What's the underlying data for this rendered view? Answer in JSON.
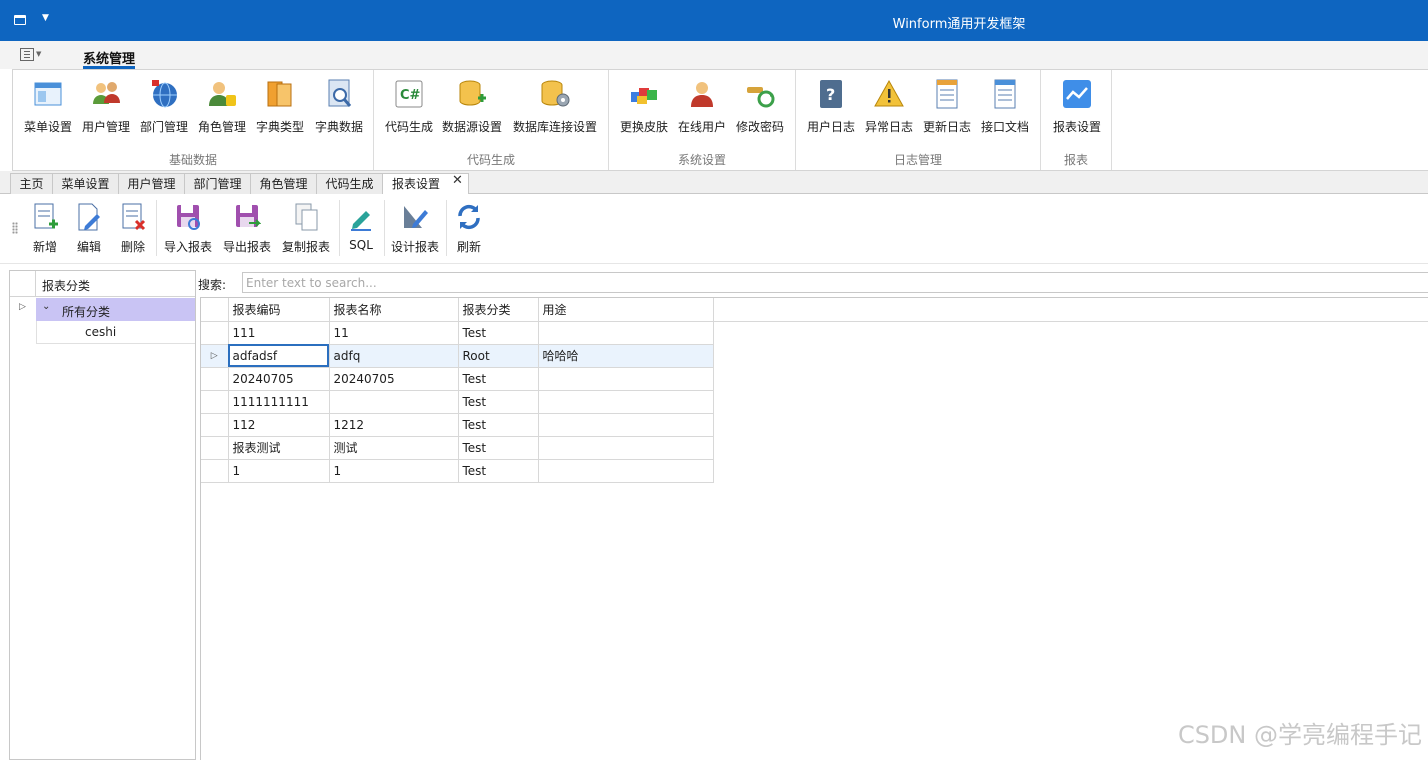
{
  "window": {
    "title": "Winform通用开发框架"
  },
  "ribbon": {
    "active_tab": "系统管理",
    "groups": [
      {
        "caption": "基础数据",
        "buttons": [
          "菜单设置",
          "用户管理",
          "部门管理",
          "角色管理",
          "字典类型",
          "字典数据"
        ]
      },
      {
        "caption": "代码生成",
        "buttons": [
          "代码生成",
          "数据源设置",
          "数据库连接设置"
        ]
      },
      {
        "caption": "系统设置",
        "buttons": [
          "更换皮肤",
          "在线用户",
          "修改密码"
        ]
      },
      {
        "caption": "日志管理",
        "buttons": [
          "用户日志",
          "异常日志",
          "更新日志",
          "接口文档"
        ]
      },
      {
        "caption": "报表",
        "buttons": [
          "报表设置"
        ]
      }
    ]
  },
  "doc_tabs": [
    "主页",
    "菜单设置",
    "用户管理",
    "部门管理",
    "角色管理",
    "代码生成",
    "报表设置"
  ],
  "doc_tabs_close": "✕",
  "toolbar": [
    "新增",
    "编辑",
    "删除",
    "导入报表",
    "导出报表",
    "复制报表",
    "SQL",
    "设计报表",
    "刷新"
  ],
  "tree": {
    "header": "报表分类",
    "root": "所有分类",
    "children": [
      "ceshi"
    ]
  },
  "search": {
    "label": "搜索:",
    "placeholder": "Enter text to search..."
  },
  "grid": {
    "columns": [
      "报表编码",
      "报表名称",
      "报表分类",
      "用途"
    ],
    "rows": [
      [
        "111",
        "11",
        "Test",
        ""
      ],
      [
        "adfadsf",
        "adfq",
        "Root",
        "哈哈哈"
      ],
      [
        "20240705",
        "20240705",
        "Test",
        ""
      ],
      [
        "1111111111",
        "",
        "Test",
        ""
      ],
      [
        "112",
        "1212",
        "Test",
        ""
      ],
      [
        "报表测试",
        "测试",
        "Test",
        ""
      ],
      [
        "1",
        "1",
        "Test",
        ""
      ]
    ]
  },
  "watermark": "CSDN @学亮编程手记"
}
